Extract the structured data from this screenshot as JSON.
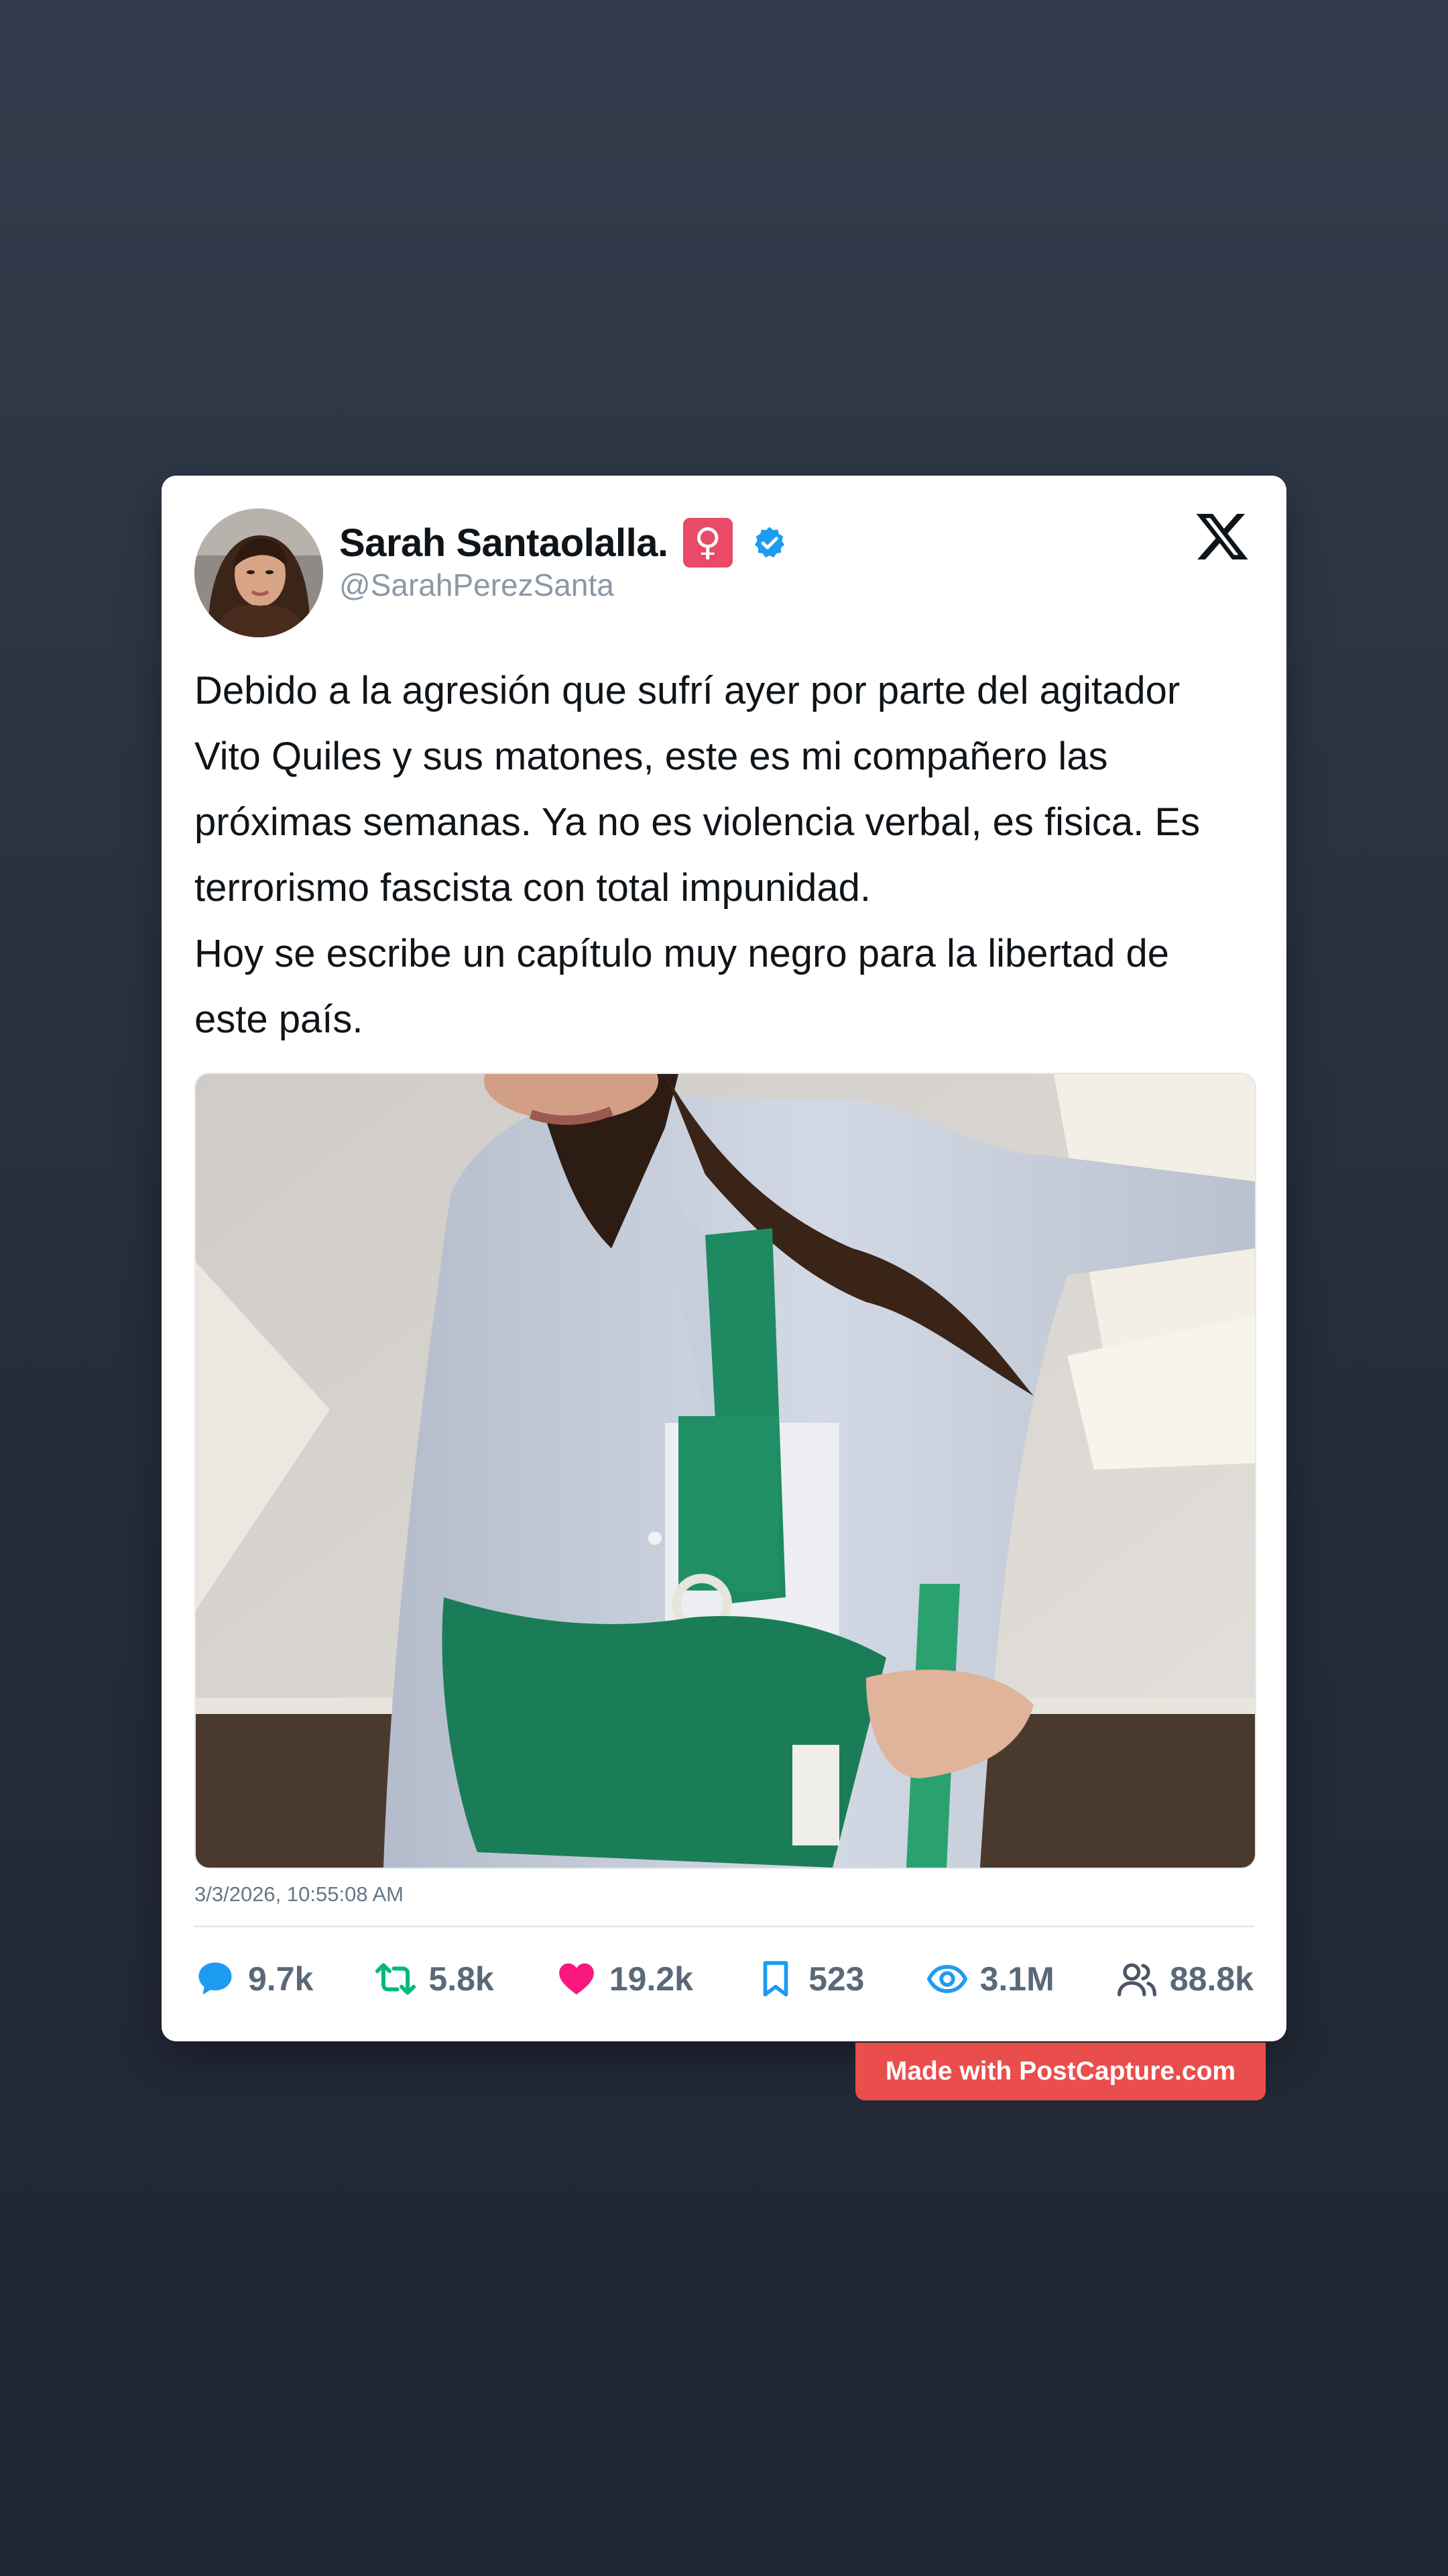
{
  "post": {
    "display_name": "Sarah Santaolalla.",
    "name_emoji": "♀",
    "handle": "@SarahPerezSanta",
    "text": "Debido a la agresión que sufrí ayer por parte del agitador\nVito Quiles y sus matones, este es mi compañero las\npróximas semanas. Ya no es violencia verbal, es fisica. Es\nterrorismo fascista con total impunidad.\nHoy se escribe un capítulo muy negro para la libertad de\neste país.",
    "timestamp": "3/3/2026, 10:55:08 AM"
  },
  "stats": {
    "replies": "9.7k",
    "reposts": "5.8k",
    "likes": "19.2k",
    "bookmarks": "523",
    "views": "3.1M",
    "followers": "88.8k"
  },
  "watermark": "Made with PostCapture.com",
  "colors": {
    "reply": "#1d9bf0",
    "repost": "#00ba7c",
    "like": "#f91880",
    "bookmark": "#1d9bf0",
    "views": "#1d9bf0",
    "followers": "#4b5563",
    "verified": "#1d9bf0",
    "watermark": "#ea4e4c"
  },
  "icons": {
    "reply": "speech-bubble-icon",
    "repost": "repost-arrows-icon",
    "like": "heart-icon",
    "bookmark": "bookmark-icon",
    "views": "eye-icon",
    "followers": "users-icon",
    "platform": "x-logo-icon",
    "verified": "verified-badge-icon"
  }
}
